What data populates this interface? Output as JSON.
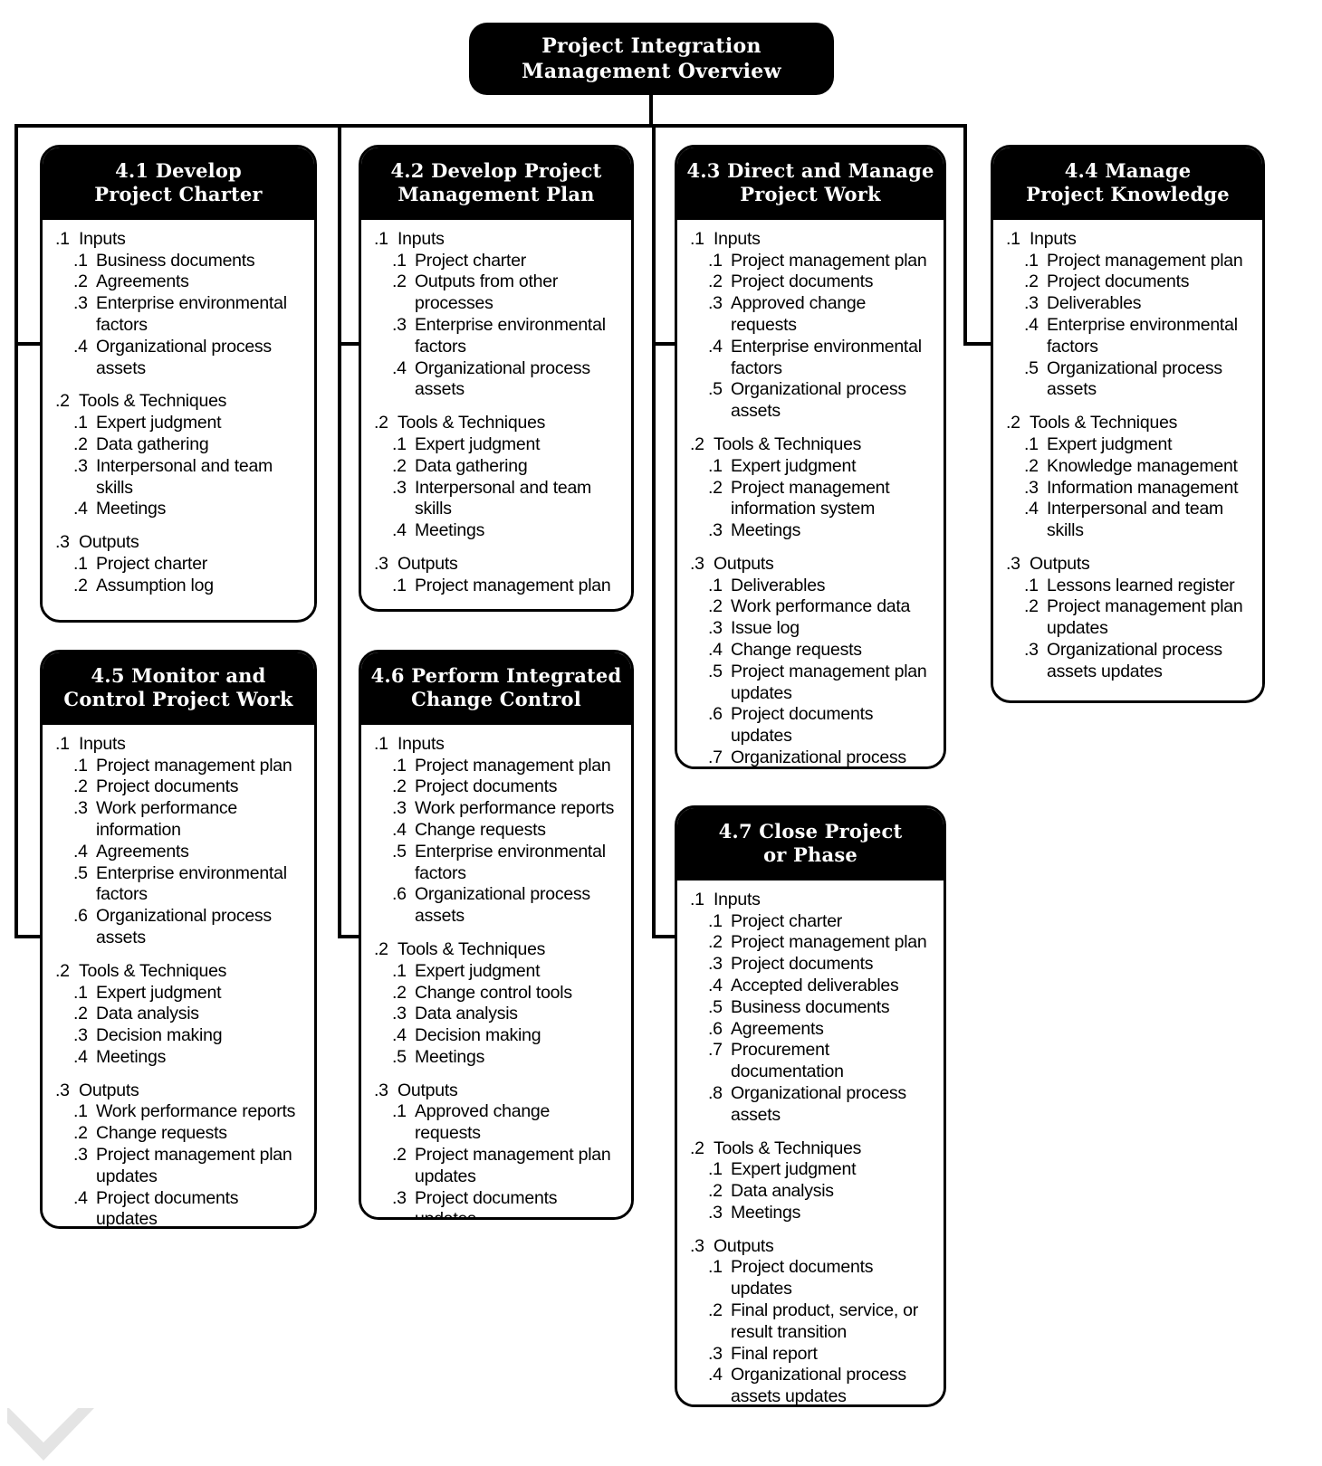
{
  "diagram": {
    "title_line1": "Project Integration",
    "title_line2": "Management Overview",
    "section_labels": {
      "inputs": "Inputs",
      "tools": "Tools & Techniques",
      "outputs": "Outputs"
    },
    "section_numbers": {
      "s1": ".1",
      "s2": ".2",
      "s3": ".3"
    },
    "accent_color": "#000000",
    "background_color": "#ffffff"
  },
  "processes": [
    {
      "id": "4.1",
      "title_line1": "4.1 Develop",
      "title_line2": "Project Charter",
      "sections": [
        {
          "num": ".1",
          "label": "Inputs",
          "items": [
            {
              "num": ".1",
              "text": "Business documents"
            },
            {
              "num": ".2",
              "text": "Agreements"
            },
            {
              "num": ".3",
              "text": "Enterprise environmental factors"
            },
            {
              "num": ".4",
              "text": "Organizational process assets"
            }
          ]
        },
        {
          "num": ".2",
          "label": "Tools & Techniques",
          "items": [
            {
              "num": ".1",
              "text": "Expert judgment"
            },
            {
              "num": ".2",
              "text": "Data gathering"
            },
            {
              "num": ".3",
              "text": "Interpersonal and team skills"
            },
            {
              "num": ".4",
              "text": "Meetings"
            }
          ]
        },
        {
          "num": ".3",
          "label": "Outputs",
          "items": [
            {
              "num": ".1",
              "text": "Project charter"
            },
            {
              "num": ".2",
              "text": "Assumption log"
            }
          ]
        }
      ]
    },
    {
      "id": "4.2",
      "title_line1": "4.2 Develop Project",
      "title_line2": "Management Plan",
      "sections": [
        {
          "num": ".1",
          "label": "Inputs",
          "items": [
            {
              "num": ".1",
              "text": "Project charter"
            },
            {
              "num": ".2",
              "text": "Outputs from other processes"
            },
            {
              "num": ".3",
              "text": "Enterprise environmental factors"
            },
            {
              "num": ".4",
              "text": "Organizational process assets"
            }
          ]
        },
        {
          "num": ".2",
          "label": "Tools & Techniques",
          "items": [
            {
              "num": ".1",
              "text": "Expert judgment"
            },
            {
              "num": ".2",
              "text": "Data gathering"
            },
            {
              "num": ".3",
              "text": "Interpersonal and team skills"
            },
            {
              "num": ".4",
              "text": "Meetings"
            }
          ]
        },
        {
          "num": ".3",
          "label": "Outputs",
          "items": [
            {
              "num": ".1",
              "text": "Project management plan"
            }
          ]
        }
      ]
    },
    {
      "id": "4.3",
      "title_line1": "4.3 Direct and Manage",
      "title_line2": "Project Work",
      "sections": [
        {
          "num": ".1",
          "label": "Inputs",
          "items": [
            {
              "num": ".1",
              "text": "Project management plan"
            },
            {
              "num": ".2",
              "text": "Project documents"
            },
            {
              "num": ".3",
              "text": "Approved change requests"
            },
            {
              "num": ".4",
              "text": "Enterprise environmental factors"
            },
            {
              "num": ".5",
              "text": "Organizational process assets"
            }
          ]
        },
        {
          "num": ".2",
          "label": "Tools & Techniques",
          "items": [
            {
              "num": ".1",
              "text": "Expert judgment"
            },
            {
              "num": ".2",
              "text": "Project management information system"
            },
            {
              "num": ".3",
              "text": "Meetings"
            }
          ]
        },
        {
          "num": ".3",
          "label": "Outputs",
          "items": [
            {
              "num": ".1",
              "text": "Deliverables"
            },
            {
              "num": ".2",
              "text": "Work performance data"
            },
            {
              "num": ".3",
              "text": "Issue log"
            },
            {
              "num": ".4",
              "text": "Change requests"
            },
            {
              "num": ".5",
              "text": "Project management plan updates"
            },
            {
              "num": ".6",
              "text": "Project documents updates"
            },
            {
              "num": ".7",
              "text": "Organizational process assets updates"
            }
          ]
        }
      ]
    },
    {
      "id": "4.4",
      "title_line1": "4.4 Manage",
      "title_line2": "Project Knowledge",
      "sections": [
        {
          "num": ".1",
          "label": "Inputs",
          "items": [
            {
              "num": ".1",
              "text": "Project management plan"
            },
            {
              "num": ".2",
              "text": "Project documents"
            },
            {
              "num": ".3",
              "text": "Deliverables"
            },
            {
              "num": ".4",
              "text": "Enterprise environmental factors"
            },
            {
              "num": ".5",
              "text": "Organizational process assets"
            }
          ]
        },
        {
          "num": ".2",
          "label": "Tools & Techniques",
          "items": [
            {
              "num": ".1",
              "text": "Expert judgment"
            },
            {
              "num": ".2",
              "text": "Knowledge management"
            },
            {
              "num": ".3",
              "text": "Information management"
            },
            {
              "num": ".4",
              "text": "Interpersonal and team skills"
            }
          ]
        },
        {
          "num": ".3",
          "label": "Outputs",
          "items": [
            {
              "num": ".1",
              "text": "Lessons learned register"
            },
            {
              "num": ".2",
              "text": "Project management plan updates"
            },
            {
              "num": ".3",
              "text": "Organizational process assets updates"
            }
          ]
        }
      ]
    },
    {
      "id": "4.5",
      "title_line1": "4.5 Monitor and",
      "title_line2": "Control Project Work",
      "sections": [
        {
          "num": ".1",
          "label": "Inputs",
          "items": [
            {
              "num": ".1",
              "text": "Project management plan"
            },
            {
              "num": ".2",
              "text": "Project documents"
            },
            {
              "num": ".3",
              "text": "Work performance information"
            },
            {
              "num": ".4",
              "text": "Agreements"
            },
            {
              "num": ".5",
              "text": "Enterprise environmental factors"
            },
            {
              "num": ".6",
              "text": "Organizational process assets"
            }
          ]
        },
        {
          "num": ".2",
          "label": "Tools & Techniques",
          "items": [
            {
              "num": ".1",
              "text": "Expert judgment"
            },
            {
              "num": ".2",
              "text": "Data analysis"
            },
            {
              "num": ".3",
              "text": "Decision making"
            },
            {
              "num": ".4",
              "text": "Meetings"
            }
          ]
        },
        {
          "num": ".3",
          "label": "Outputs",
          "items": [
            {
              "num": ".1",
              "text": "Work performance reports"
            },
            {
              "num": ".2",
              "text": "Change requests"
            },
            {
              "num": ".3",
              "text": "Project management plan updates"
            },
            {
              "num": ".4",
              "text": "Project documents updates"
            }
          ]
        }
      ]
    },
    {
      "id": "4.6",
      "title_line1": "4.6 Perform Integrated",
      "title_line2": "Change Control",
      "sections": [
        {
          "num": ".1",
          "label": "Inputs",
          "items": [
            {
              "num": ".1",
              "text": "Project management plan"
            },
            {
              "num": ".2",
              "text": "Project documents"
            },
            {
              "num": ".3",
              "text": "Work performance reports"
            },
            {
              "num": ".4",
              "text": "Change requests"
            },
            {
              "num": ".5",
              "text": "Enterprise environmental factors"
            },
            {
              "num": ".6",
              "text": "Organizational process assets"
            }
          ]
        },
        {
          "num": ".2",
          "label": "Tools & Techniques",
          "items": [
            {
              "num": ".1",
              "text": "Expert judgment"
            },
            {
              "num": ".2",
              "text": "Change control tools"
            },
            {
              "num": ".3",
              "text": "Data analysis"
            },
            {
              "num": ".4",
              "text": "Decision making"
            },
            {
              "num": ".5",
              "text": "Meetings"
            }
          ]
        },
        {
          "num": ".3",
          "label": "Outputs",
          "items": [
            {
              "num": ".1",
              "text": "Approved change requests"
            },
            {
              "num": ".2",
              "text": "Project management plan updates"
            },
            {
              "num": ".3",
              "text": "Project documents updates"
            }
          ]
        }
      ]
    },
    {
      "id": "4.7",
      "title_line1": "4.7 Close Project",
      "title_line2": "or Phase",
      "sections": [
        {
          "num": ".1",
          "label": "Inputs",
          "items": [
            {
              "num": ".1",
              "text": "Project charter"
            },
            {
              "num": ".2",
              "text": "Project management plan"
            },
            {
              "num": ".3",
              "text": "Project documents"
            },
            {
              "num": ".4",
              "text": "Accepted deliverables"
            },
            {
              "num": ".5",
              "text": "Business documents"
            },
            {
              "num": ".6",
              "text": "Agreements"
            },
            {
              "num": ".7",
              "text": "Procurement documentation"
            },
            {
              "num": ".8",
              "text": "Organizational process assets"
            }
          ]
        },
        {
          "num": ".2",
          "label": "Tools & Techniques",
          "items": [
            {
              "num": ".1",
              "text": "Expert judgment"
            },
            {
              "num": ".2",
              "text": "Data analysis"
            },
            {
              "num": ".3",
              "text": "Meetings"
            }
          ]
        },
        {
          "num": ".3",
          "label": "Outputs",
          "items": [
            {
              "num": ".1",
              "text": "Project documents updates"
            },
            {
              "num": ".2",
              "text": "Final product, service, or result transition"
            },
            {
              "num": ".3",
              "text": "Final report"
            },
            {
              "num": ".4",
              "text": "Organizational process assets updates"
            }
          ]
        }
      ]
    }
  ]
}
